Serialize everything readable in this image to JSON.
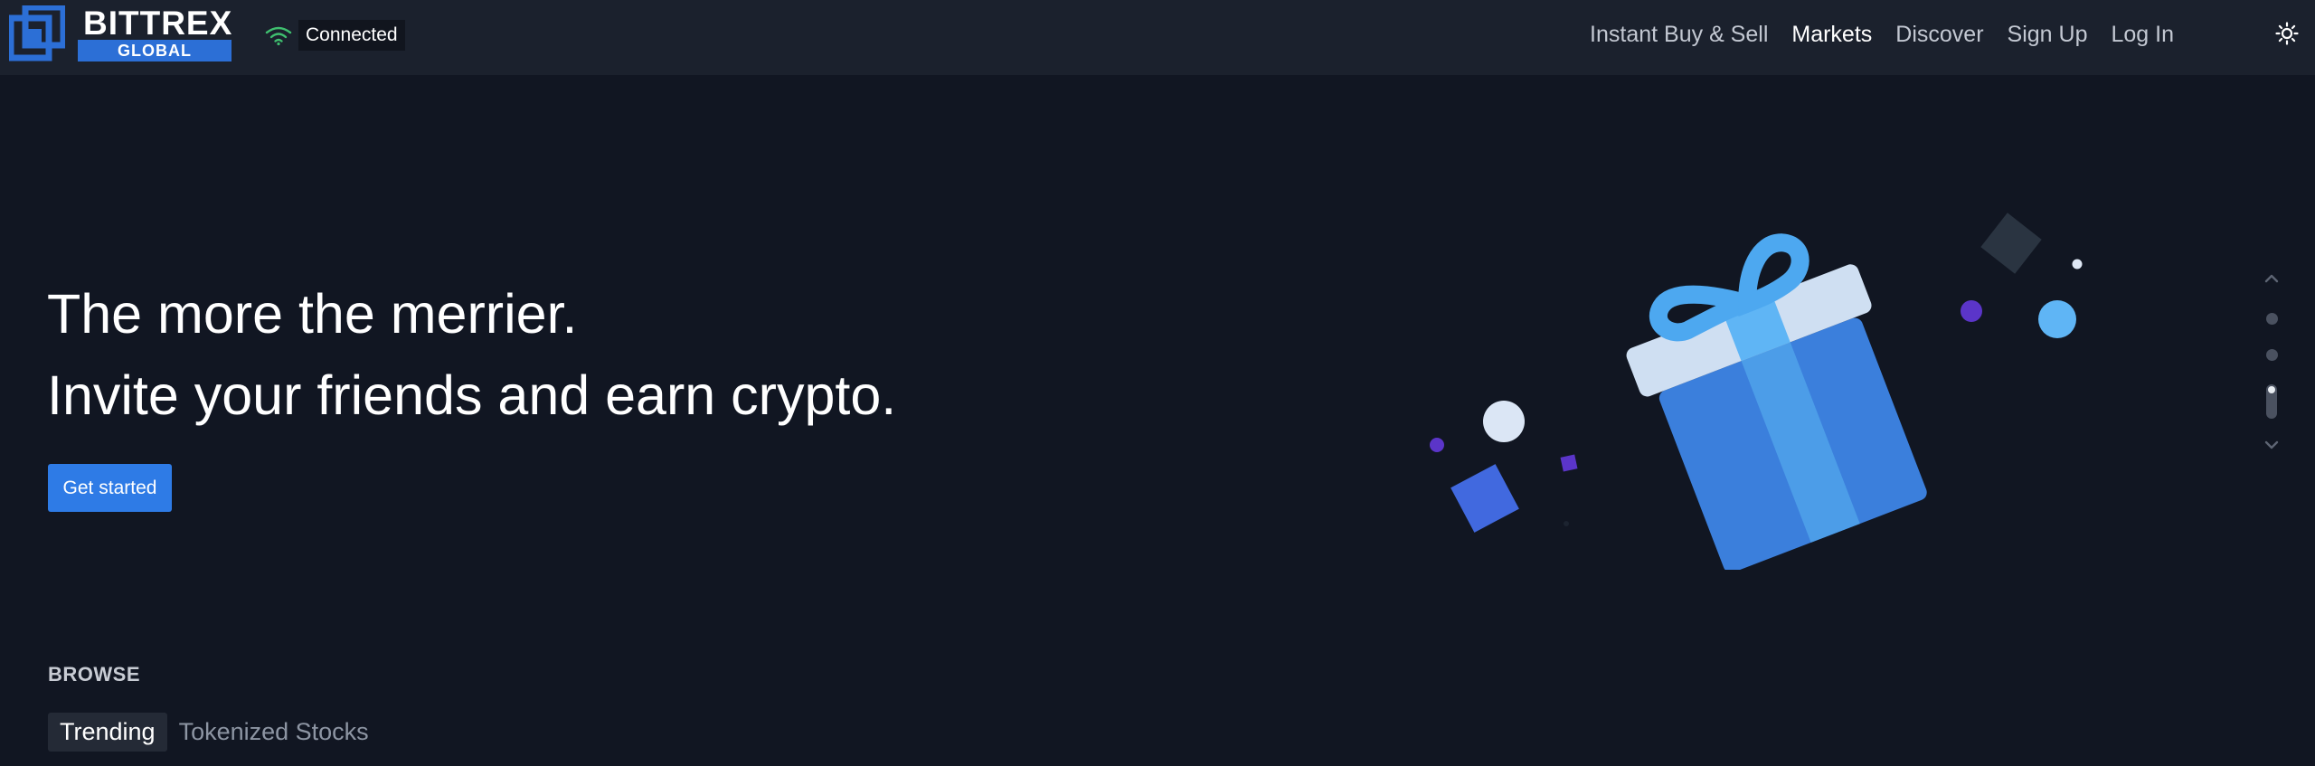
{
  "brand": {
    "name": "BITTREX",
    "sub": "GLOBAL",
    "accent": "#2c6fd6"
  },
  "connection": {
    "status": "Connected",
    "icon": "wifi-icon",
    "color": "#3fbf6f"
  },
  "nav": {
    "items": [
      {
        "label": "Instant Buy & Sell",
        "active": false
      },
      {
        "label": "Markets",
        "active": true
      },
      {
        "label": "Discover",
        "active": false
      },
      {
        "label": "Sign Up",
        "active": false
      },
      {
        "label": "Log In",
        "active": false
      }
    ],
    "theme_icon": "sun-icon"
  },
  "hero": {
    "line1": "The more the merrier.",
    "line2": "Invite your friends and earn crypto.",
    "cta": "Get started",
    "cta_color": "#2e7be6",
    "illustration": "gift-box"
  },
  "carousel": {
    "slides": 4,
    "active_slide": 3
  },
  "browse": {
    "heading": "BROWSE",
    "tabs": [
      {
        "label": "Trending",
        "active": true
      },
      {
        "label": "Tokenized Stocks",
        "active": false
      }
    ]
  }
}
